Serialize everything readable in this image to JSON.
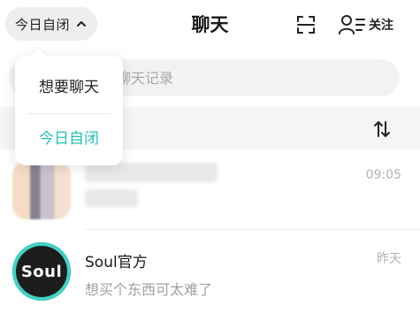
{
  "header": {
    "status_label": "今日自闭",
    "title": "聊天",
    "contacts_label": "关注"
  },
  "search": {
    "placeholder": "搜索昵称或者聊天记录",
    "visible_fragment": "或者聊天记录"
  },
  "status_menu": {
    "items": [
      {
        "label": "想要聊天",
        "selected": false
      },
      {
        "label": "今日自闭",
        "selected": true
      }
    ]
  },
  "list": {
    "section_title_fragment": "",
    "chats": [
      {
        "name": "",
        "preview": "",
        "time": "09:05",
        "avatar": "blurred-photo"
      },
      {
        "name": "Soul官方",
        "preview": "想买个东西可太难了",
        "time": "昨天",
        "avatar_text": "Soul"
      }
    ]
  },
  "colors": {
    "accent": "#25c3b7",
    "soul_ring": "#3fd3c7",
    "pill_bg": "#eeeeee",
    "search_bg": "#f2f2f2",
    "section_bg": "#f5f5f5"
  },
  "icons": [
    "chevron-up-icon",
    "scan-icon",
    "contacts-icon",
    "sort-icon"
  ]
}
